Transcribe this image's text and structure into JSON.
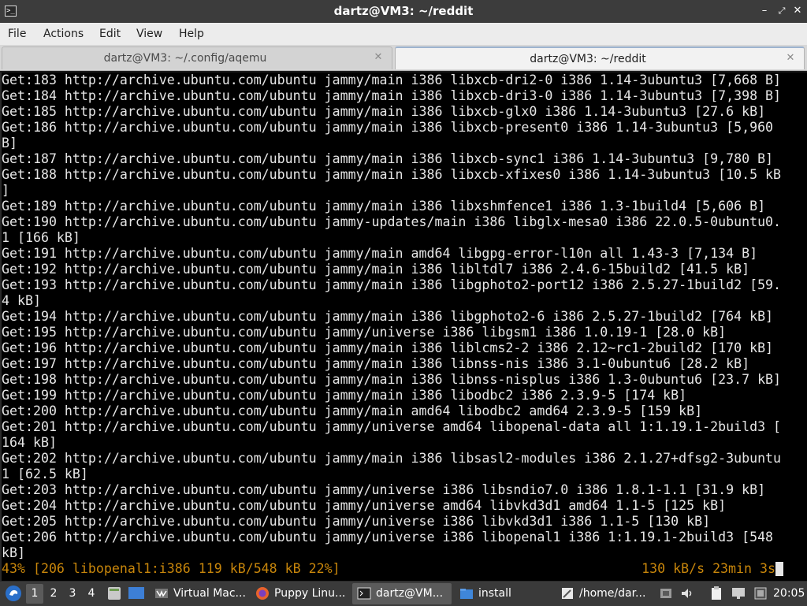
{
  "window": {
    "title": "dartz@VM3: ~/reddit",
    "menu": [
      "File",
      "Actions",
      "Edit",
      "View",
      "Help"
    ],
    "tabs": [
      {
        "label": "dartz@VM3: ~/.config/aqemu",
        "active": false
      },
      {
        "label": "dartz@VM3: ~/reddit",
        "active": true
      }
    ],
    "icons": {
      "app": "terminal-icon",
      "minimize": "minimize-icon",
      "maximize": "maximize-icon",
      "close": "close-icon"
    }
  },
  "terminal": {
    "lines": [
      "Get:183 http://archive.ubuntu.com/ubuntu jammy/main i386 libxcb-dri2-0 i386 1.14-3ubuntu3 [7,668 B]",
      "Get:184 http://archive.ubuntu.com/ubuntu jammy/main i386 libxcb-dri3-0 i386 1.14-3ubuntu3 [7,398 B]",
      "Get:185 http://archive.ubuntu.com/ubuntu jammy/main i386 libxcb-glx0 i386 1.14-3ubuntu3 [27.6 kB]",
      "Get:186 http://archive.ubuntu.com/ubuntu jammy/main i386 libxcb-present0 i386 1.14-3ubuntu3 [5,960",
      "B]",
      "Get:187 http://archive.ubuntu.com/ubuntu jammy/main i386 libxcb-sync1 i386 1.14-3ubuntu3 [9,780 B]",
      "Get:188 http://archive.ubuntu.com/ubuntu jammy/main i386 libxcb-xfixes0 i386 1.14-3ubuntu3 [10.5 kB",
      "]",
      "Get:189 http://archive.ubuntu.com/ubuntu jammy/main i386 libxshmfence1 i386 1.3-1build4 [5,606 B]",
      "Get:190 http://archive.ubuntu.com/ubuntu jammy-updates/main i386 libglx-mesa0 i386 22.0.5-0ubuntu0.",
      "1 [166 kB]",
      "Get:191 http://archive.ubuntu.com/ubuntu jammy/main amd64 libgpg-error-l10n all 1.43-3 [7,134 B]",
      "Get:192 http://archive.ubuntu.com/ubuntu jammy/main i386 libltdl7 i386 2.4.6-15build2 [41.5 kB]",
      "Get:193 http://archive.ubuntu.com/ubuntu jammy/main i386 libgphoto2-port12 i386 2.5.27-1build2 [59.",
      "4 kB]",
      "Get:194 http://archive.ubuntu.com/ubuntu jammy/main i386 libgphoto2-6 i386 2.5.27-1build2 [764 kB]",
      "Get:195 http://archive.ubuntu.com/ubuntu jammy/universe i386 libgsm1 i386 1.0.19-1 [28.0 kB]",
      "Get:196 http://archive.ubuntu.com/ubuntu jammy/main i386 liblcms2-2 i386 2.12~rc1-2build2 [170 kB]",
      "Get:197 http://archive.ubuntu.com/ubuntu jammy/main i386 libnss-nis i386 3.1-0ubuntu6 [28.2 kB]",
      "Get:198 http://archive.ubuntu.com/ubuntu jammy/main i386 libnss-nisplus i386 1.3-0ubuntu6 [23.7 kB]",
      "Get:199 http://archive.ubuntu.com/ubuntu jammy/main i386 libodbc2 i386 2.3.9-5 [174 kB]",
      "Get:200 http://archive.ubuntu.com/ubuntu jammy/main amd64 libodbc2 amd64 2.3.9-5 [159 kB]",
      "Get:201 http://archive.ubuntu.com/ubuntu jammy/universe amd64 libopenal-data all 1:1.19.1-2build3 [",
      "164 kB]",
      "Get:202 http://archive.ubuntu.com/ubuntu jammy/main i386 libsasl2-modules i386 2.1.27+dfsg2-3ubuntu",
      "1 [62.5 kB]",
      "Get:203 http://archive.ubuntu.com/ubuntu jammy/universe i386 libsndio7.0 i386 1.8.1-1.1 [31.9 kB]",
      "Get:204 http://archive.ubuntu.com/ubuntu jammy/universe amd64 libvkd3d1 amd64 1.1-5 [125 kB]",
      "Get:205 http://archive.ubuntu.com/ubuntu jammy/universe i386 libvkd3d1 i386 1.1-5 [130 kB]",
      "Get:206 http://archive.ubuntu.com/ubuntu jammy/universe i386 libopenal1 i386 1:1.19.1-2build3 [548",
      "kB]"
    ],
    "progress_left": "43% [206 libopenal1:i386 119 kB/548 kB 22%]",
    "progress_right": "130 kB/s 23min 3s",
    "colors": {
      "background": "#000000",
      "text": "#e6e6e6",
      "progress": "#c8860b"
    }
  },
  "taskbar": {
    "workspaces": [
      "1",
      "2",
      "3",
      "4"
    ],
    "active_workspace": "1",
    "tasks": [
      {
        "label": "Virtual Mac...",
        "icon": "virtual-machine-icon",
        "active": false
      },
      {
        "label": "Puppy Linu...",
        "icon": "firefox-icon",
        "active": false
      },
      {
        "label": "dartz@VM...",
        "icon": "terminal-icon",
        "active": true
      },
      {
        "label": "install",
        "icon": "folder-icon",
        "active": false
      },
      {
        "label": "/home/dar...",
        "icon": "text-editor-icon",
        "active": false
      }
    ],
    "clock": "20:05",
    "tray_icons": [
      "network-icon",
      "volume-icon",
      "clipboard-icon",
      "display-icon",
      "cpu-monitor-icon"
    ]
  }
}
